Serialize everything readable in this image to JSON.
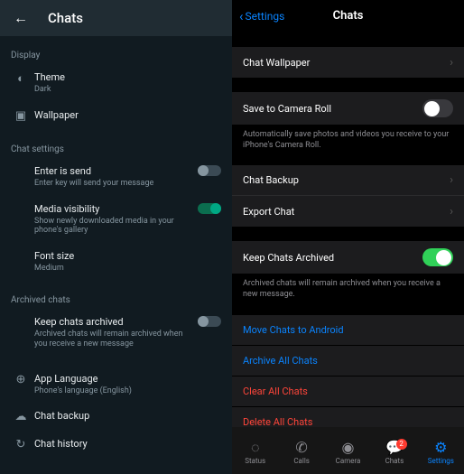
{
  "left": {
    "title": "Chats",
    "sections": {
      "display": "Display",
      "chat_settings": "Chat settings",
      "archived": "Archived chats"
    },
    "theme": {
      "label": "Theme",
      "value": "Dark"
    },
    "wallpaper": {
      "label": "Wallpaper"
    },
    "enter_send": {
      "label": "Enter is send",
      "sub": "Enter key will send your message"
    },
    "media_vis": {
      "label": "Media visibility",
      "sub": "Show newly downloaded media in your phone's gallery"
    },
    "font_size": {
      "label": "Font size",
      "value": "Medium"
    },
    "keep_archived": {
      "label": "Keep chats archived",
      "sub": "Archived chats will remain archived when you receive a new message"
    },
    "app_lang": {
      "label": "App Language",
      "value": "Phone's language (English)"
    },
    "chat_backup": {
      "label": "Chat backup"
    },
    "chat_history": {
      "label": "Chat history"
    }
  },
  "right": {
    "back": "Settings",
    "title": "Chats",
    "wallpaper": "Chat Wallpaper",
    "camera_roll": {
      "label": "Save to Camera Roll",
      "foot": "Automatically save photos and videos you receive to your iPhone's Camera Roll."
    },
    "backup": "Chat Backup",
    "export": "Export Chat",
    "keep_archived": {
      "label": "Keep Chats Archived",
      "foot": "Archived chats will remain archived when you receive a new message."
    },
    "move_android": "Move Chats to Android",
    "archive_all": "Archive All Chats",
    "clear_all": "Clear All Chats",
    "delete_all": "Delete All Chats",
    "tabs": {
      "status": "Status",
      "calls": "Calls",
      "camera": "Camera",
      "chats": "Chats",
      "settings": "Settings",
      "badge": "2"
    }
  }
}
